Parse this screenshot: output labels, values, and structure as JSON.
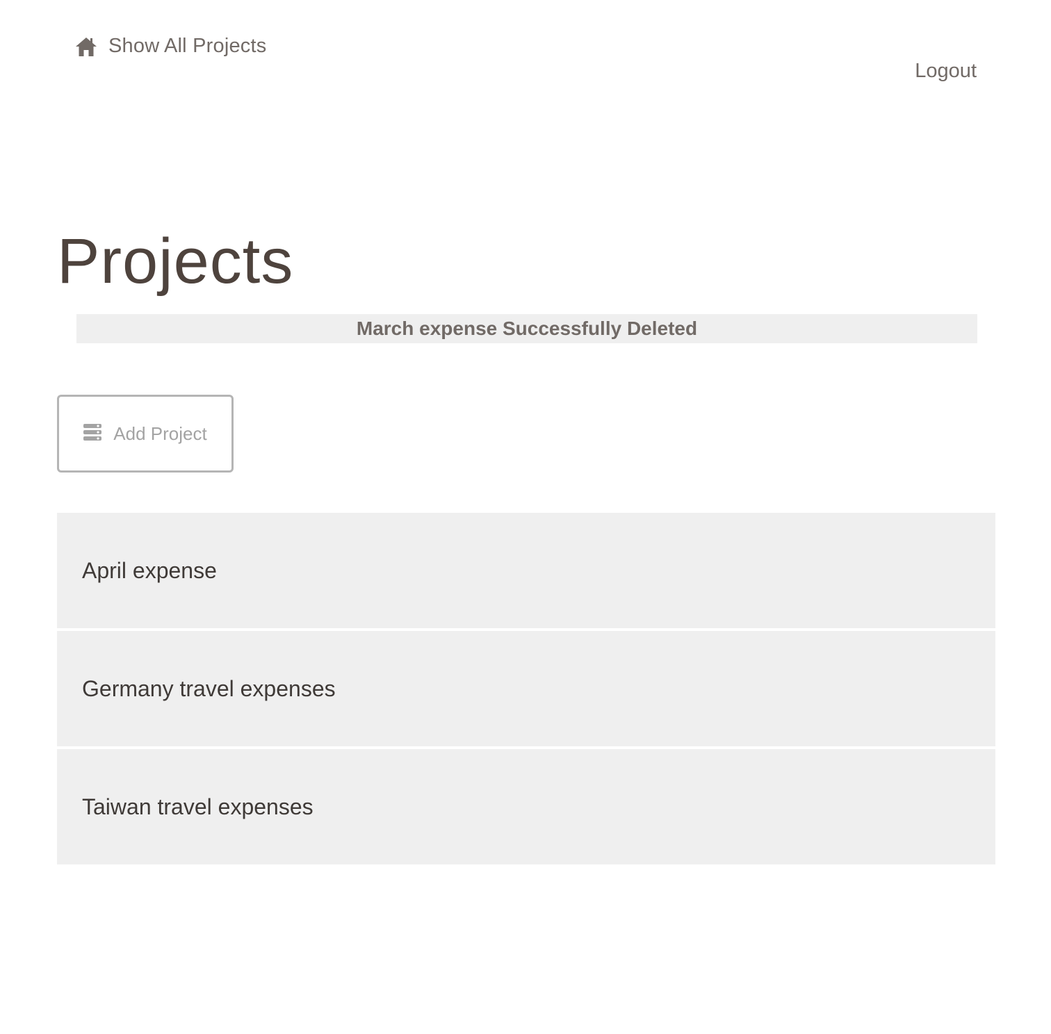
{
  "nav": {
    "home_label": "Show All Projects",
    "home_icon": "home-icon",
    "logout_label": "Logout"
  },
  "main": {
    "title": "Projects",
    "flash_message": "March expense Successfully Deleted",
    "add_button": {
      "label": "Add Project",
      "icon": "list-stack-icon"
    },
    "projects": [
      {
        "name": "April expense"
      },
      {
        "name": "Germany travel expenses"
      },
      {
        "name": "Taiwan travel expenses"
      }
    ]
  },
  "colors": {
    "text_nav": "#716a66",
    "title": "#4e433d",
    "panel_bg": "#efefef",
    "button_border": "#b5b5b5",
    "button_text": "#a3a3a3"
  }
}
